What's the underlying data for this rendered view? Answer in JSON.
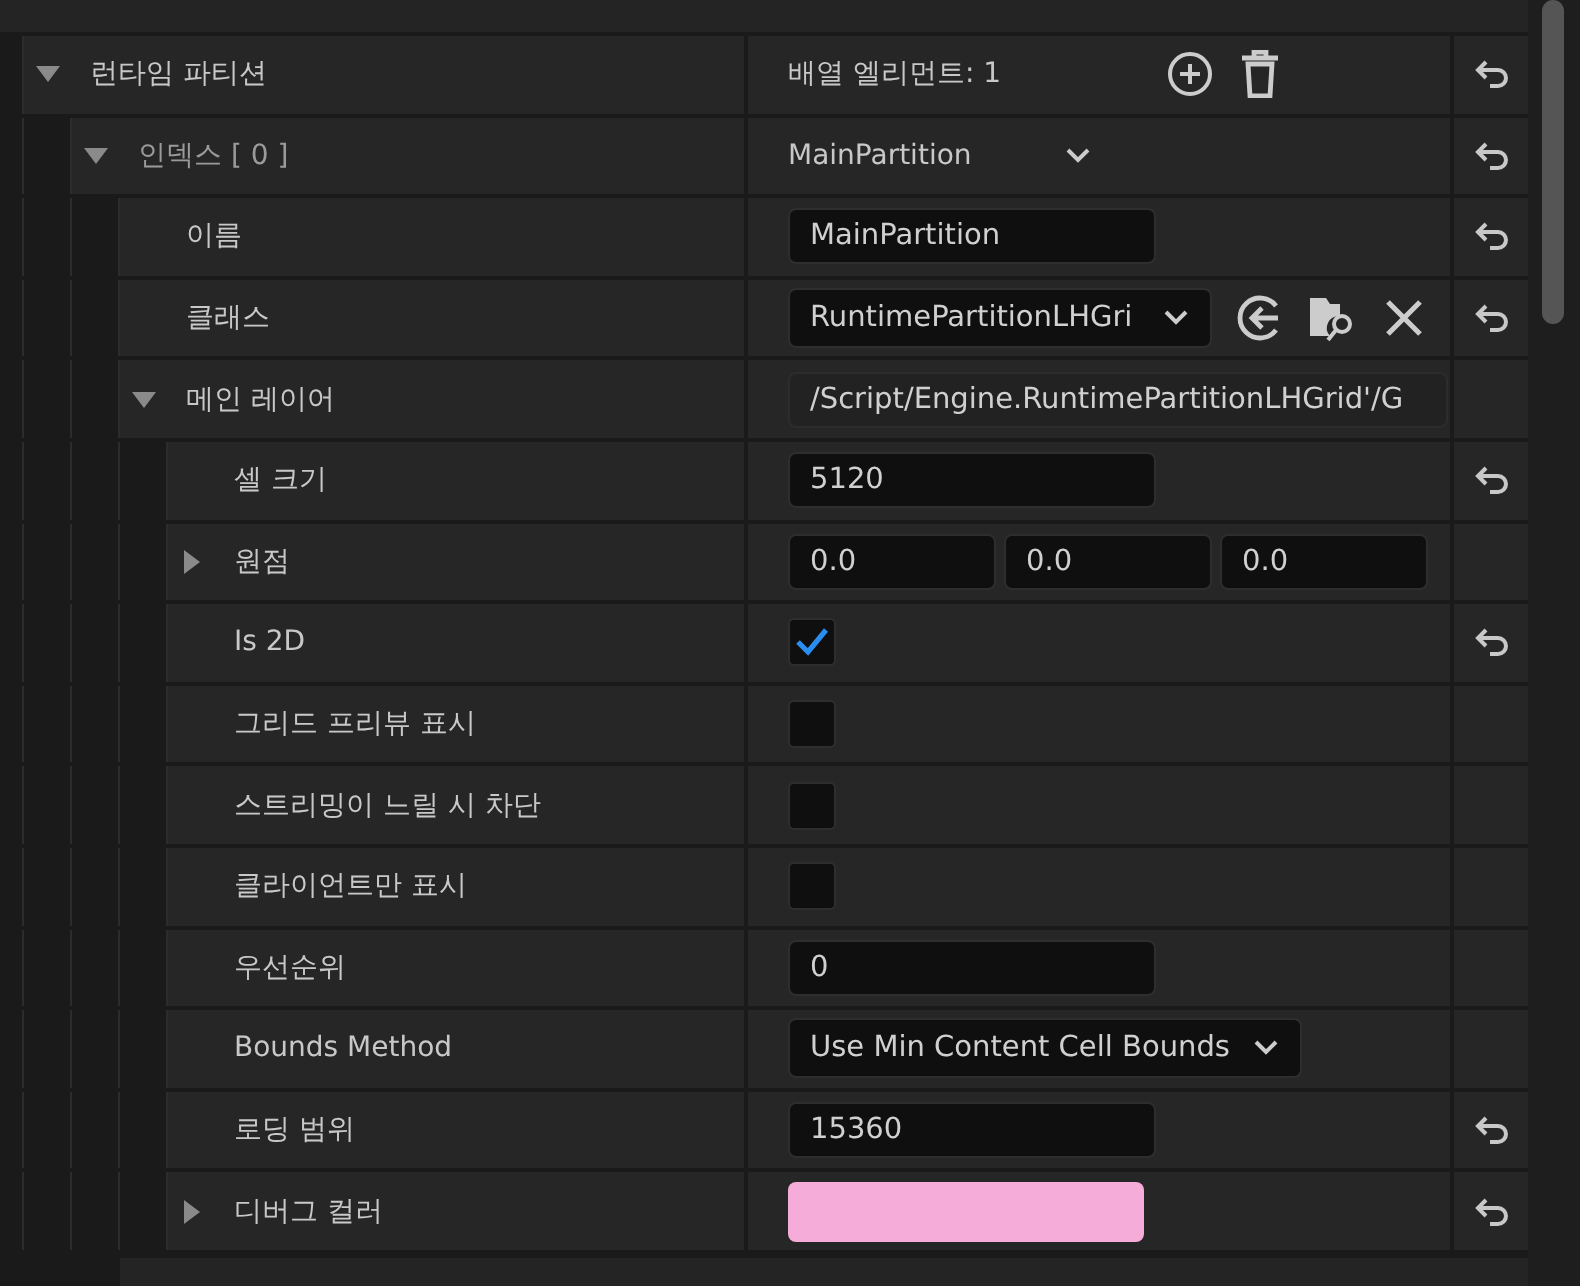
{
  "rows": [
    {
      "label": "런타임 파티션",
      "expanded": true,
      "value": {
        "kind": "array",
        "text": "배열 엘리먼트: 1"
      },
      "resettable": true,
      "children": [
        {
          "label": "인덱스 [ 0 ]",
          "expanded": true,
          "value": {
            "kind": "select",
            "text": "MainPartition"
          },
          "resettable": true,
          "children": [
            {
              "label": "이름",
              "value": {
                "kind": "text",
                "text": "MainPartition"
              },
              "resettable": true
            },
            {
              "label": "클래스",
              "value": {
                "kind": "class",
                "text": "RuntimePartitionLHGri"
              },
              "resettable": true
            },
            {
              "label": "메인 레이어",
              "expanded": true,
              "value": {
                "kind": "path",
                "text": "/Script/Engine.RuntimePartitionLHGrid'/G"
              },
              "resettable": false,
              "children": [
                {
                  "label": "셀 크기",
                  "value": {
                    "kind": "text",
                    "text": "5120"
                  },
                  "resettable": true
                },
                {
                  "label": "원점",
                  "expanded": false,
                  "value": {
                    "kind": "vector",
                    "parts": [
                      "0.0",
                      "0.0",
                      "0.0"
                    ]
                  },
                  "resettable": false
                },
                {
                  "label": "Is 2D",
                  "value": {
                    "kind": "checkbox",
                    "checked": true
                  },
                  "resettable": true
                },
                {
                  "label": "그리드 프리뷰 표시",
                  "value": {
                    "kind": "checkbox",
                    "checked": false
                  },
                  "resettable": false
                },
                {
                  "label": "스트리밍이 느릴 시 차단",
                  "value": {
                    "kind": "checkbox",
                    "checked": false
                  },
                  "resettable": false
                },
                {
                  "label": "클라이언트만 표시",
                  "value": {
                    "kind": "checkbox",
                    "checked": false
                  },
                  "resettable": false
                },
                {
                  "label": "우선순위",
                  "value": {
                    "kind": "text",
                    "text": "0"
                  },
                  "resettable": false
                },
                {
                  "label": "Bounds Method",
                  "value": {
                    "kind": "combo",
                    "text": "Use Min Content Cell Bounds"
                  },
                  "resettable": false
                },
                {
                  "label": "로딩 범위",
                  "value": {
                    "kind": "text",
                    "text": "15360"
                  },
                  "resettable": true
                },
                {
                  "label": "디버그 컬러",
                  "expanded": false,
                  "value": {
                    "kind": "color",
                    "color": "#f5acd9"
                  },
                  "resettable": true
                }
              ]
            }
          ]
        }
      ]
    }
  ]
}
